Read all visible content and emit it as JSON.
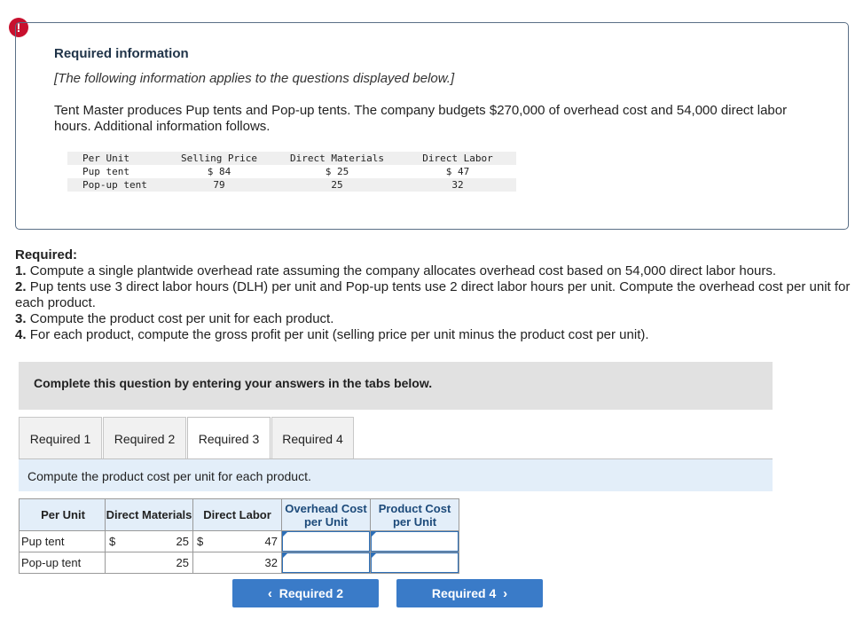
{
  "alert": {
    "symbol": "!"
  },
  "info": {
    "title": "Required information",
    "italic_note": "[The following information applies to the questions displayed below.]",
    "description": "Tent Master produces Pup tents and Pop-up tents. The company budgets $270,000 of overhead cost and 54,000 direct labor hours. Additional information follows.",
    "table": {
      "headers": [
        "Per Unit",
        "Selling Price",
        "Direct Materials",
        "Direct Labor"
      ],
      "rows": [
        [
          "Pup tent",
          "$ 84",
          "$ 25",
          "$ 47"
        ],
        [
          "Pop-up tent",
          "79",
          "25",
          "32"
        ]
      ]
    }
  },
  "required": {
    "heading": "Required:",
    "items": [
      {
        "num": "1.",
        "text": "Compute a single plantwide overhead rate assuming the company allocates overhead cost based on 54,000 direct labor hours."
      },
      {
        "num": "2.",
        "text": "Pup tents use 3 direct labor hours (DLH) per unit and Pop-up tents use 2 direct labor hours per unit. Compute the overhead cost per unit for each product."
      },
      {
        "num": "3.",
        "text": "Compute the product cost per unit for each product."
      },
      {
        "num": "4.",
        "text": "For each product, compute the gross profit per unit (selling price per unit minus the product cost per unit)."
      }
    ]
  },
  "complete_note": "Complete this question by entering your answers in the tabs below.",
  "tabs": [
    "Required 1",
    "Required 2",
    "Required 3",
    "Required 4"
  ],
  "active_tab": "Required 3",
  "prompt": "Compute the product cost per unit for each product.",
  "answer_table": {
    "headers": [
      "Per Unit",
      "Direct Materials",
      "Direct Labor",
      "Overhead Cost per Unit",
      "Product Cost per Unit"
    ],
    "rows": [
      {
        "label": "Pup tent",
        "dm_symbol": "$",
        "dm": "25",
        "dl_symbol": "$",
        "dl": "47",
        "overhead": "",
        "product_cost": ""
      },
      {
        "label": "Pop-up tent",
        "dm_symbol": "",
        "dm": "25",
        "dl_symbol": "",
        "dl": "32",
        "overhead": "",
        "product_cost": ""
      }
    ]
  },
  "nav": {
    "prev": "Required 2",
    "next": "Required 4"
  },
  "colors": {
    "accent": "#3a7bc8",
    "alert": "#c8102e",
    "prompt_bg": "#e3eef9"
  }
}
